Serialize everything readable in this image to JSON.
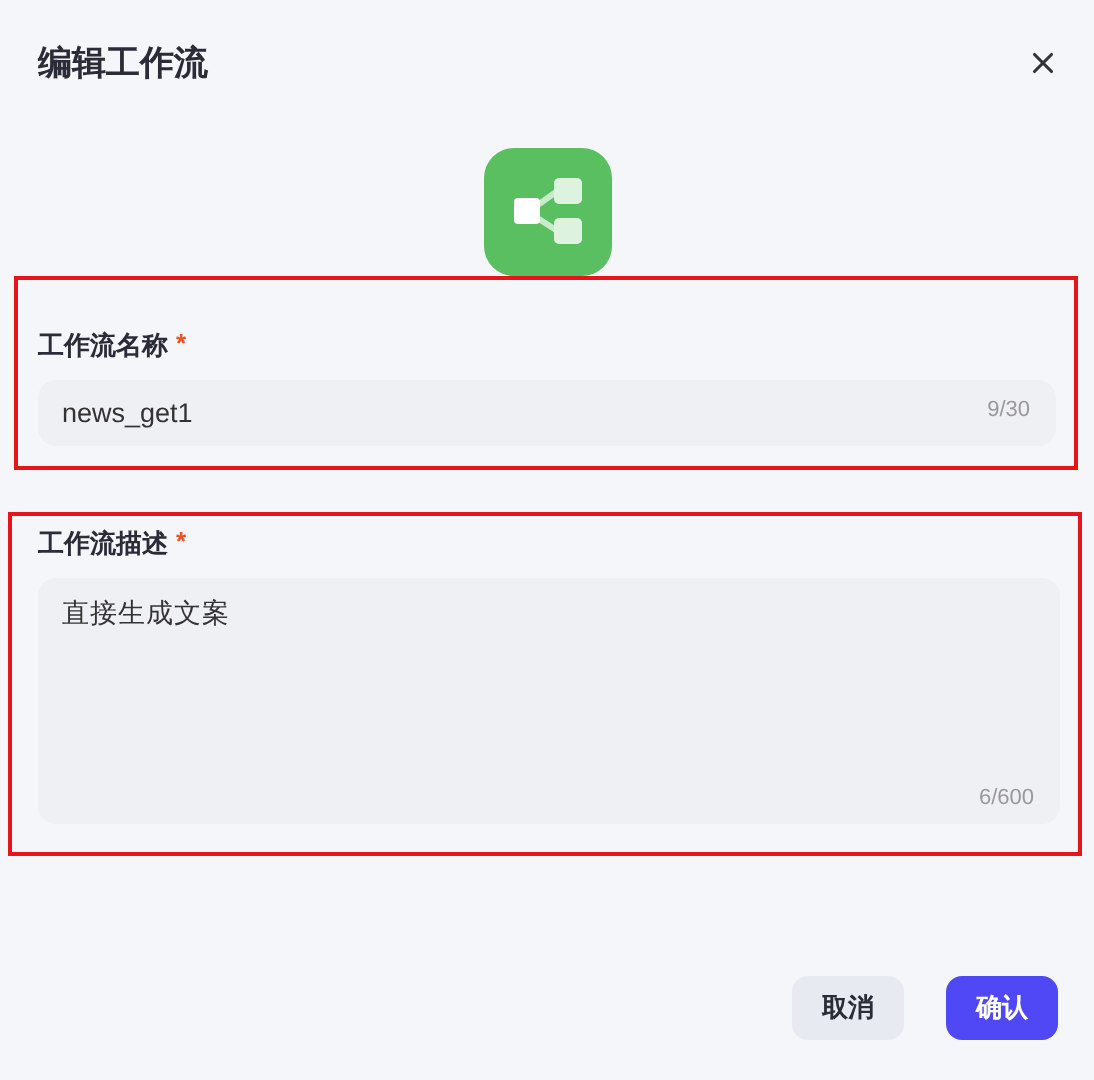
{
  "dialog": {
    "title": "编辑工作流"
  },
  "fields": [
    {
      "kind": "input",
      "label": "工作流名称",
      "required_mark": "*",
      "highlighted": true,
      "value": "news_get1",
      "counter": "9/30"
    },
    {
      "kind": "textarea",
      "label": "工作流描述",
      "required_mark": "*",
      "highlighted": true,
      "value": "直接生成文案",
      "counter": "6/600"
    }
  ],
  "buttons": [
    {
      "label": "取消",
      "primary": false
    },
    {
      "label": "确认",
      "primary": true
    }
  ]
}
